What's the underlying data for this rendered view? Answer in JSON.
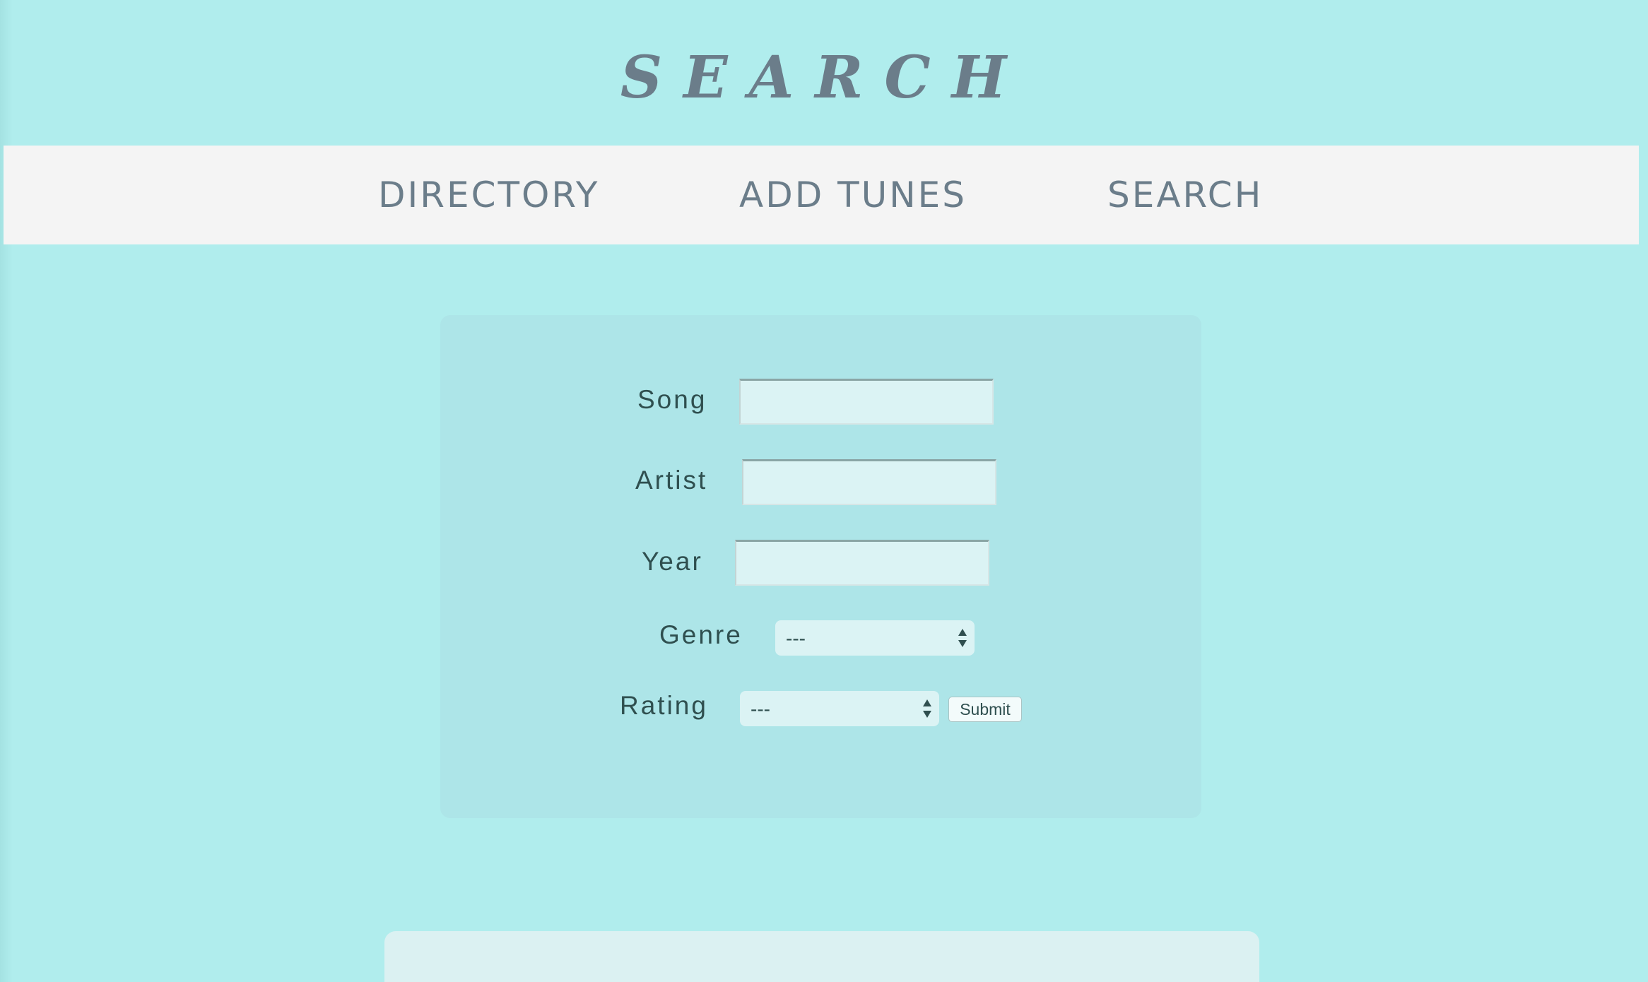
{
  "page_title": "SEARCH",
  "nav": {
    "items": [
      {
        "label": "DIRECTORY"
      },
      {
        "label": "ADD TUNES"
      },
      {
        "label": "SEARCH"
      }
    ]
  },
  "form": {
    "song": {
      "label": "Song",
      "value": ""
    },
    "artist": {
      "label": "Artist",
      "value": ""
    },
    "year": {
      "label": "Year",
      "value": ""
    },
    "genre": {
      "label": "Genre",
      "selected": "---"
    },
    "rating": {
      "label": "Rating",
      "selected": "---"
    },
    "submit_label": "Submit"
  },
  "colors": {
    "background": "#b0eded",
    "navbar": "#f4f4f4",
    "panel": "#ade5e8",
    "input": "#dbf3f4",
    "title_text": "#6b7d8a",
    "label_text": "#2f4f4f"
  },
  "icons": {
    "select_arrows": "up-down-arrows-icon"
  }
}
